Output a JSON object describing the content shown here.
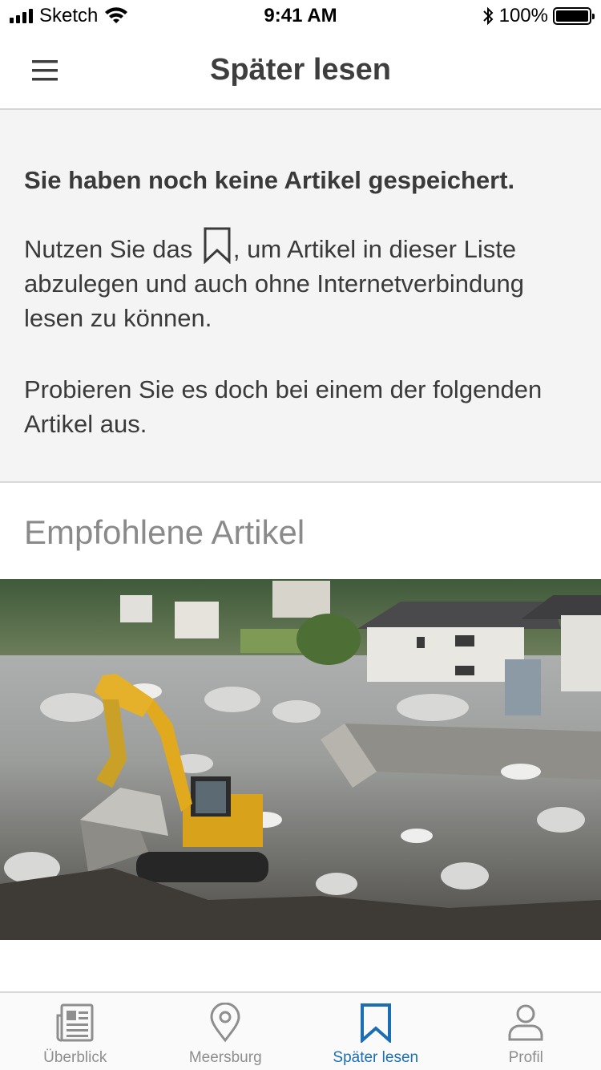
{
  "status_bar": {
    "carrier": "Sketch",
    "time": "9:41 AM",
    "battery": "100%"
  },
  "header": {
    "title": "Später lesen",
    "menu_icon": "hamburger-menu-icon"
  },
  "empty_state": {
    "heading": "Sie haben noch keine Artikel gespeichert.",
    "p1_before": "Nutzen Sie das",
    "p1_after": ", um Artikel in dieser Liste abzulegen und auch ohne Internetverbindung lesen zu können.",
    "p2": "Probieren Sie es doch bei einem der folgenden Artikel aus.",
    "inline_icon": "bookmark-icon"
  },
  "recommended": {
    "title": "Empfohlene Artikel"
  },
  "tabs": [
    {
      "label": "Überblick",
      "icon": "newspaper-icon",
      "active": false
    },
    {
      "label": "Meersburg",
      "icon": "location-pin-icon",
      "active": false
    },
    {
      "label": "Später lesen",
      "icon": "bookmark-icon",
      "active": true
    },
    {
      "label": "Profil",
      "icon": "person-icon",
      "active": false
    }
  ],
  "colors": {
    "accent": "#1b6eb3",
    "inactive": "#8e8e8e",
    "panel_background": "#f4f4f4"
  }
}
